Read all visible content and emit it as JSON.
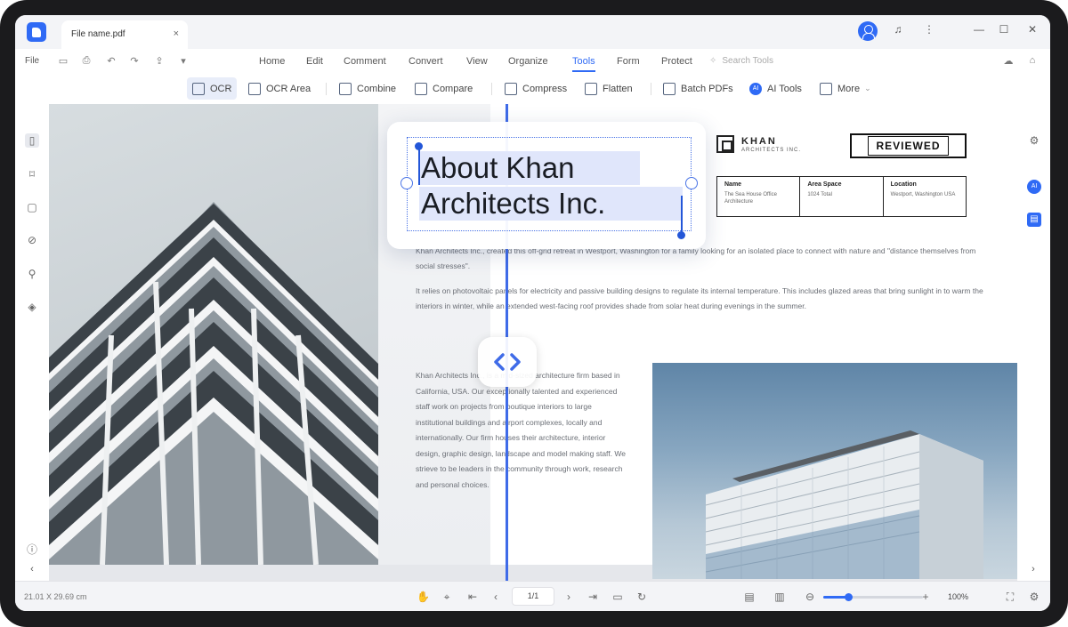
{
  "window": {
    "tab_title": "File name.pdf",
    "tab_close": "×",
    "controls": {
      "notifications": "♫",
      "more": "⋮",
      "minimize": "—",
      "maximize": "☐",
      "close": "✕"
    }
  },
  "menu": {
    "file": "File",
    "items": [
      "Home",
      "Edit",
      "Comment",
      "Convert",
      "View",
      "Organize",
      "Tools",
      "Form",
      "Protect"
    ],
    "active": "Tools",
    "search_placeholder": "Search Tools"
  },
  "ribbon": {
    "buttons": [
      "OCR",
      "OCR Area",
      "Combine",
      "Compare",
      "Compress",
      "Flatten",
      "Batch PDFs",
      "AI Tools",
      "More"
    ],
    "selected": "OCR",
    "ai_badge": "AI",
    "more_chevron": "⌄"
  },
  "right_sidebar": {
    "ai_label": "AI"
  },
  "document": {
    "heading_line1": "About Khan",
    "heading_line2": "Architects Inc.",
    "logo_name": "KHAN",
    "logo_sub": "ARCHITECTS INC.",
    "stamp": "REVIEWED",
    "info": [
      {
        "head": "Name",
        "val": "The Sea House Office Architecture"
      },
      {
        "head": "Area Space",
        "val": "1024 Total"
      },
      {
        "head": "Location",
        "val": "Westport, Washington USA"
      }
    ],
    "para1": "Khan Architects Inc., created this off-grid retreat in Westport, Washington for a family looking for an isolated place to connect with nature and \"distance themselves from social stresses\".",
    "para2": "It relies on photovoltaic panels for electricity and passive building designs to regulate its internal temperature. This includes glazed areas that bring sunlight in to warm the interiors in winter, while an extended west-facing roof provides shade from solar heat during evenings in the summer.",
    "para3": "Khan Architects Inc., is a mid-sized architecture firm based in California, USA. Our exceptionally talented and experienced staff work on projects from boutique interiors to large institutional buildings and airport complexes, locally and internationally. Our firm houses their architecture, interior design, graphic design, landscape and model making staff. We strieve to be leaders in the community through work, research and personal choices."
  },
  "status": {
    "dimensions": "21.01 X 29.69 cm",
    "page": "1/1",
    "zoom_level": "100%",
    "zoom_fraction": 0.25
  },
  "colors": {
    "accent": "#2f6af5",
    "divider": "#3f6be8"
  }
}
